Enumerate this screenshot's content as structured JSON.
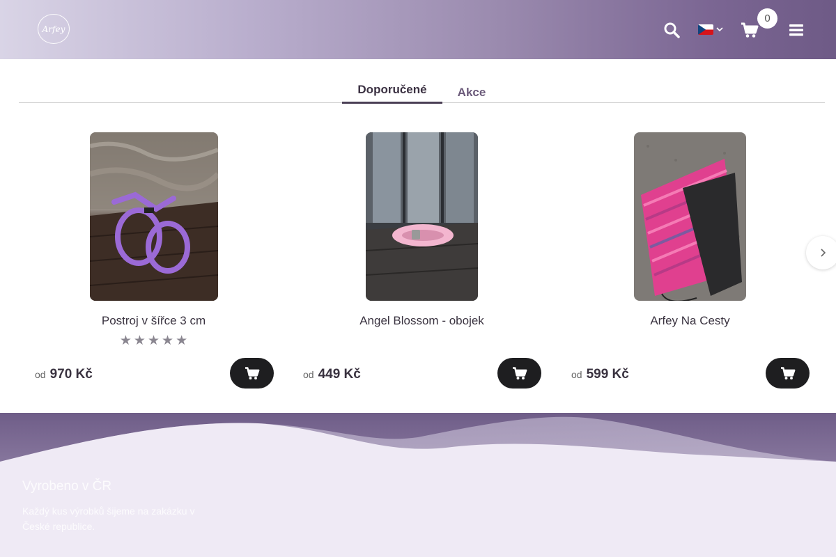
{
  "header": {
    "logo_text": "Arfey",
    "cart_count": "0"
  },
  "tabs": [
    {
      "label": "Doporučené",
      "active": true
    },
    {
      "label": "Akce",
      "active": false
    }
  ],
  "products": [
    {
      "name": "Postroj v šířce 3 cm",
      "price_prefix": "od",
      "price": "970 Kč",
      "rating": 5
    },
    {
      "name": "Angel Blossom - obojek",
      "price_prefix": "od",
      "price": "449 Kč"
    },
    {
      "name": "Arfey Na Cesty",
      "price_prefix": "od",
      "price": "599 Kč"
    }
  ],
  "footer": {
    "title": "Vyrobeno v ČR",
    "text": "Každý kus výrobků šijeme na zakázku v České republice."
  },
  "colors": {
    "header_start": "#d9d4e6",
    "header_end": "#6e5a86",
    "button": "#1e1e20"
  }
}
